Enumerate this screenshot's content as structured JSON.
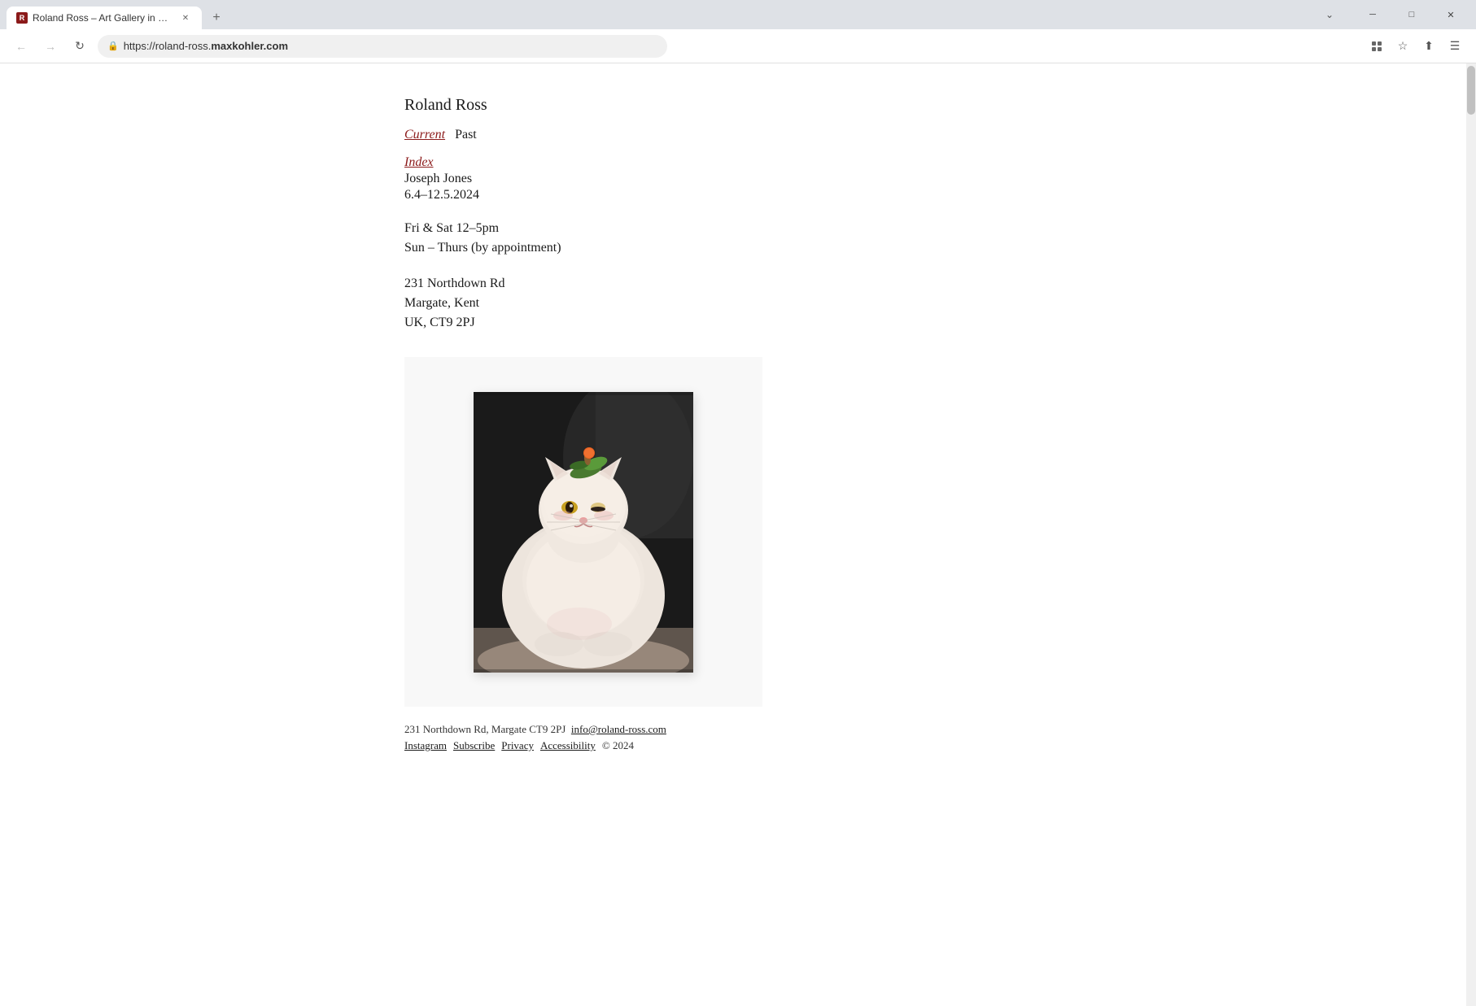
{
  "browser": {
    "tab_title": "Roland Ross – Art Gallery in Ma…",
    "tab_favicon_letter": "R",
    "address_url": "https://roland-ross.maxkohler.com",
    "address_url_display": "https://roland-ross.",
    "address_domain": "maxkohler.com"
  },
  "site": {
    "title": "Roland Ross",
    "nav": {
      "current_label": "Current",
      "past_label": "Past"
    },
    "exhibition": {
      "index_label": "Index",
      "artist": "Joseph Jones",
      "dates": "6.4–12.5.2024",
      "hours_line1": "Fri & Sat 12–5pm",
      "hours_line2": "Sun – Thurs (by appointment)"
    },
    "address": {
      "line1": "231 Northdown Rd",
      "line2": "Margate, Kent",
      "line3": "UK, CT9 2PJ"
    },
    "footer": {
      "address": "231 Northdown Rd, Margate CT9 2PJ",
      "email": "info@roland-ross.com",
      "links": [
        "Instagram",
        "Subscribe",
        "Privacy",
        "Accessibility"
      ],
      "copyright": "© 2024"
    }
  }
}
